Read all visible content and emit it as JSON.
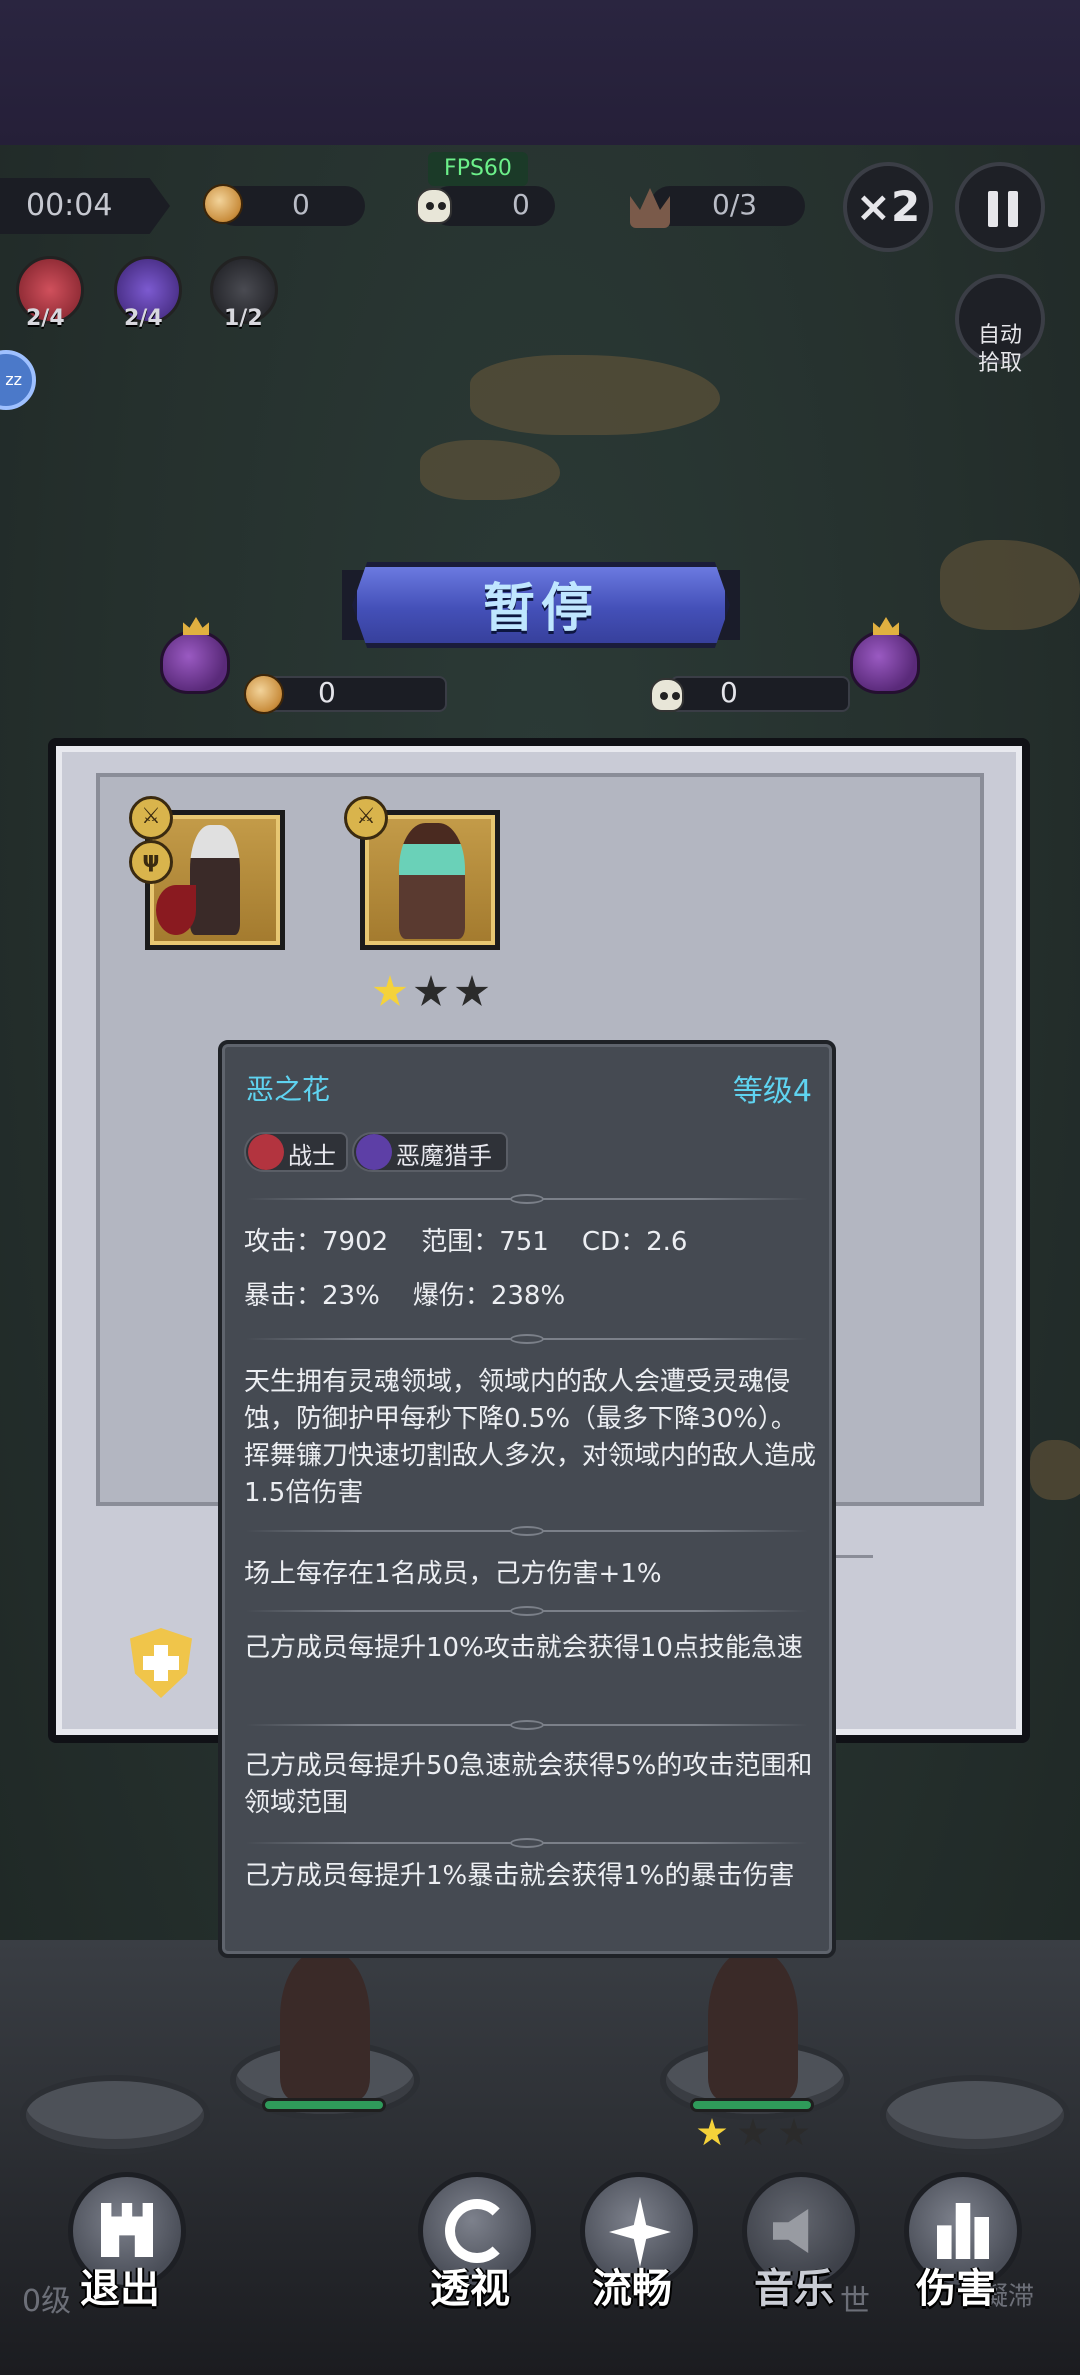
{
  "hud": {
    "fps": "FPS60",
    "timer": "00:04",
    "coins": "0",
    "kills": "0",
    "boss_progress": "0/3",
    "speed_label": "×2",
    "auto_pickup": "自动\n拾取",
    "skills": [
      {
        "name": "sword-skill",
        "count": "2/4",
        "color": "#b3343f"
      },
      {
        "name": "claw-skill",
        "count": "2/4",
        "color": "#5d3fa6"
      },
      {
        "name": "dagger-skill",
        "count": "1/2",
        "color": "#2a2b30"
      }
    ],
    "z_badge": "zz"
  },
  "pause": {
    "title": "暂停",
    "coins": "0",
    "kills": "0"
  },
  "heroes": [
    {
      "name": "scythe-hero",
      "badges": [
        "sword",
        "claw"
      ],
      "stars_on": 0
    },
    {
      "name": "hunter-hero",
      "badges": [
        "sword"
      ],
      "stars_on": 1,
      "stars_total": 3
    }
  ],
  "tooltip": {
    "name": "恶之花",
    "level": "等级4",
    "tags": [
      {
        "label": "战士",
        "color": "#b3343f"
      },
      {
        "label": "恶魔猎手",
        "color": "#5d3fa6"
      }
    ],
    "stats_line1": "攻击：7902    范围：751    CD：2.6",
    "stats_line2": "暴击：23%    爆伤：238%",
    "description": "天生拥有灵魂领域，领域内的敌人会遭受灵魂侵蚀，防御护甲每秒下降0.5%（最多下降30%）。挥舞镰刀快速切割敌人多次，对领域内的敌人造成1.5倍伤害",
    "passives": [
      "场上每存在1名成员，己方伤害+1%",
      "己方成员每提升10%攻击就会获得10点技能急速",
      "己方成员每提升50急速就会获得5%的攻击范围和领域范围",
      "己方成员每提升1%暴击就会获得1%的暴击伤害"
    ]
  },
  "bottom": {
    "level_text": "0级",
    "right_faint_1": "世",
    "right_faint_2": "凝滞",
    "buttons": [
      {
        "name": "exit",
        "label": "退出"
      },
      {
        "name": "perspective",
        "label": "透视"
      },
      {
        "name": "smooth",
        "label": "流畅"
      },
      {
        "name": "music",
        "label": "音乐"
      },
      {
        "name": "damage",
        "label": "伤害"
      }
    ]
  },
  "colors": {
    "accent_cyan": "#5fd3f0",
    "banner_blue": "#4450b8",
    "gold": "#f5d23a"
  }
}
